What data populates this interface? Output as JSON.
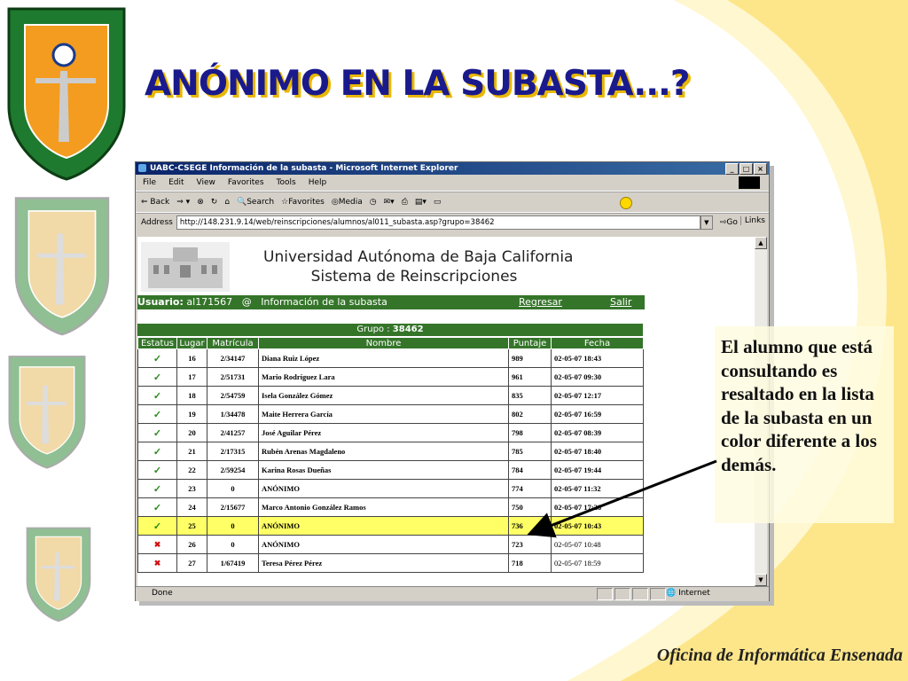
{
  "slide": {
    "title": "ANÓNIMO EN LA SUBASTA...?",
    "note": "El alumno que está consultando es resaltado en la lista de la subasta en un color diferente a los demás.",
    "footer": "Oficina de Informática Ensenada"
  },
  "browser": {
    "title": "UABC-CSEGE Información de la subasta - Microsoft Internet Explorer",
    "menu": [
      "File",
      "Edit",
      "View",
      "Favorites",
      "Tools",
      "Help"
    ],
    "toolbar": {
      "back": "⇐ Back",
      "search": "Search",
      "favorites": "Favorites",
      "media": "Media"
    },
    "address_label": "Address",
    "url": "http://148.231.9.14/web/reinscripciones/alumnos/al011_subasta.asp?grupo=38462",
    "go": "Go",
    "links": "Links",
    "status": "Done",
    "zone": "Internet"
  },
  "page": {
    "university": "Universidad Autónoma de Baja California",
    "system": "Sistema de Reinscripciones",
    "user_label": "Usuario:",
    "user_id": "al171567",
    "at": "@",
    "section": "Información de la subasta",
    "regresar": "Regresar",
    "salir": "Salir",
    "grupo_label": "Grupo :",
    "grupo_value": "38462",
    "columns": [
      "Estatus",
      "Lugar",
      "Matrícula",
      "Nombre",
      "Puntaje",
      "Fecha"
    ],
    "rows": [
      {
        "status": "ok",
        "lugar": "16",
        "matricula": "2/34147",
        "nombre": "Diana Ruiz López",
        "puntaje": "989",
        "fecha": "02-05-07 18:43"
      },
      {
        "status": "ok",
        "lugar": "17",
        "matricula": "2/51731",
        "nombre": "Mario Rodríguez Lara",
        "puntaje": "961",
        "fecha": "02-05-07 09:30"
      },
      {
        "status": "ok",
        "lugar": "18",
        "matricula": "2/54759",
        "nombre": "Isela González Gómez",
        "puntaje": "835",
        "fecha": "02-05-07 12:17"
      },
      {
        "status": "ok",
        "lugar": "19",
        "matricula": "1/34478",
        "nombre": "Maite Herrera García",
        "puntaje": "802",
        "fecha": "02-05-07 16:59"
      },
      {
        "status": "ok",
        "lugar": "20",
        "matricula": "2/41257",
        "nombre": "José Aguilar Pérez",
        "puntaje": "798",
        "fecha": "02-05-07 08:39"
      },
      {
        "status": "ok",
        "lugar": "21",
        "matricula": "2/17315",
        "nombre": "Rubén Arenas Magdaleno",
        "puntaje": "785",
        "fecha": "02-05-07 18:40"
      },
      {
        "status": "ok",
        "lugar": "22",
        "matricula": "2/59254",
        "nombre": "Karina Rosas Dueñas",
        "puntaje": "784",
        "fecha": "02-05-07 19:44"
      },
      {
        "status": "ok",
        "lugar": "23",
        "matricula": "0",
        "nombre": "ANÓNIMO",
        "puntaje": "774",
        "fecha": "02-05-07 11:32"
      },
      {
        "status": "ok",
        "lugar": "24",
        "matricula": "2/15677",
        "nombre": "Marco Antonio González Ramos",
        "puntaje": "750",
        "fecha": "02-05-07 17:28"
      },
      {
        "status": "ok",
        "lugar": "25",
        "matricula": "0",
        "nombre": "ANÓNIMO",
        "puntaje": "736",
        "fecha": "02-05-07 10:43",
        "highlight": true
      },
      {
        "status": "no",
        "lugar": "26",
        "matricula": "0",
        "nombre": "ANÓNIMO",
        "puntaje": "723",
        "fecha": "02-05-07 10:48"
      },
      {
        "status": "no",
        "lugar": "27",
        "matricula": "1/67419",
        "nombre": "Teresa Pérez Pérez",
        "puntaje": "718",
        "fecha": "02-05-07 18:59"
      }
    ]
  },
  "colors": {
    "accent_green": "#35752a",
    "highlight": "#ffff66",
    "title": "#1a1a8c"
  }
}
